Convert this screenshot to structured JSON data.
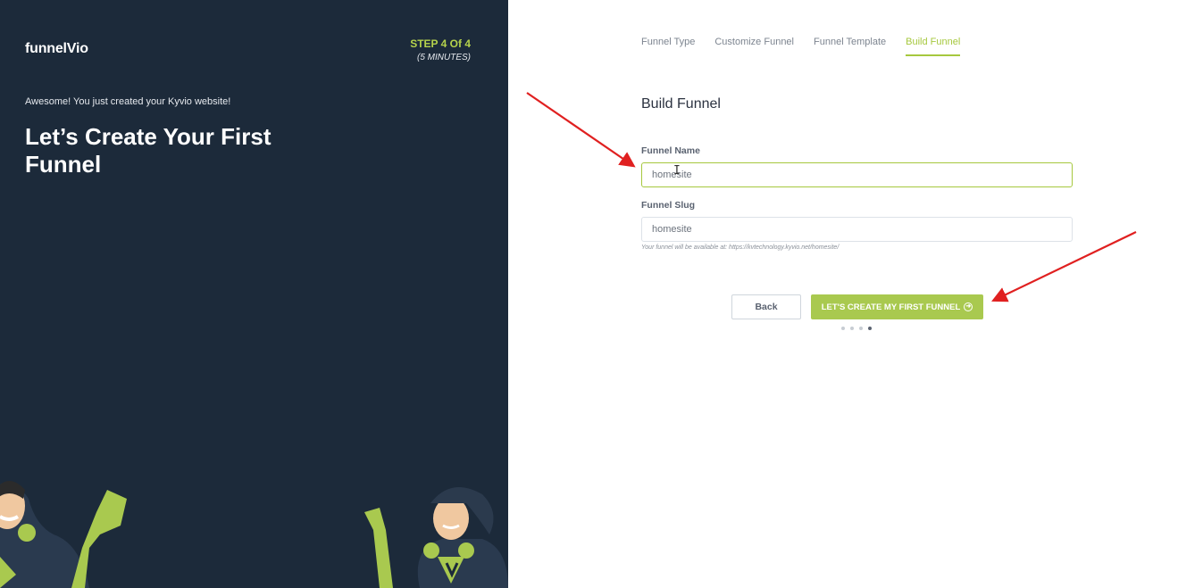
{
  "brand": {
    "logo_text": "funnelVio"
  },
  "step": {
    "title": "STEP 4 Of 4",
    "subtitle": "(5 MINUTES)"
  },
  "intro_text": "Awesome! You just created your Kyvio website!",
  "headline": "Let’s Create Your First Funnel",
  "tabs": [
    {
      "label": "Funnel Type",
      "active": false
    },
    {
      "label": "Customize Funnel",
      "active": false
    },
    {
      "label": "Funnel Template",
      "active": false
    },
    {
      "label": "Build Funnel",
      "active": true
    }
  ],
  "form": {
    "title": "Build Funnel",
    "funnel_name": {
      "label": "Funnel Name",
      "value": "homesite",
      "focused": true
    },
    "funnel_slug": {
      "label": "Funnel Slug",
      "value": "homesite"
    },
    "help_text": "Your funnel will be available at: https://kvtechnology.kyvio.net/homesite/"
  },
  "buttons": {
    "back": "Back",
    "create": "LET'S CREATE MY FIRST FUNNEL",
    "create_icon": "arrow-circle-icon"
  },
  "pager": {
    "total": 4,
    "active_index": 3
  },
  "colors": {
    "left_panel": "#1c2a3a",
    "accent": "#a9c94f",
    "annotation_arrow": "#e02020"
  }
}
